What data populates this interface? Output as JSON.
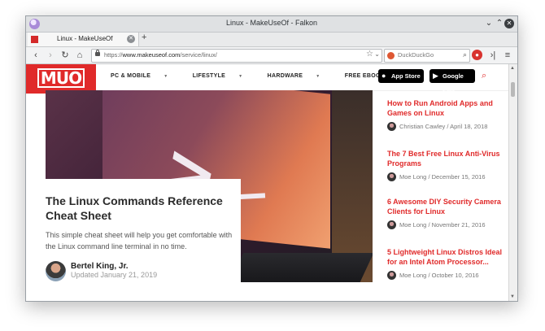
{
  "window": {
    "title": "Linux - MakeUseOf - Falkon"
  },
  "tabs": [
    {
      "label": "Linux - MakeUseOf"
    }
  ],
  "navbar": {
    "url_prefix": "https://",
    "url_host": "www.makeuseof.com",
    "url_path": "/service/linux/",
    "search_placeholder": "DuckDuckGo"
  },
  "site": {
    "logo": "MUO",
    "menu": [
      "PC & MOBILE",
      "LIFESTYLE",
      "HARDWARE",
      "FREE EBOOKS"
    ],
    "app_store": "App Store",
    "google_play": "Google Play"
  },
  "hero": {
    "title": "The Linux Commands Reference Cheat Sheet",
    "description": "This simple cheat sheet will help you get comfortable with the Linux command line terminal in no time.",
    "author": "Bertel King, Jr.",
    "date": "Updated January 21, 2019",
    "image_glyph": ">"
  },
  "sidebar": [
    {
      "title": "How to Run Android Apps and Games on Linux",
      "author": "Christian Cawley",
      "date": "April 18, 2018"
    },
    {
      "title": "The 7 Best Free Linux Anti-Virus Programs",
      "author": "Moe Long",
      "date": "December 15, 2016"
    },
    {
      "title": "6 Awesome DIY Security Camera Clients for Linux",
      "author": "Moe Long",
      "date": "November 21, 2016"
    },
    {
      "title": "5 Lightweight Linux Distros Ideal for an Intel Atom Processor...",
      "author": "Moe Long",
      "date": "October 10, 2016"
    }
  ]
}
